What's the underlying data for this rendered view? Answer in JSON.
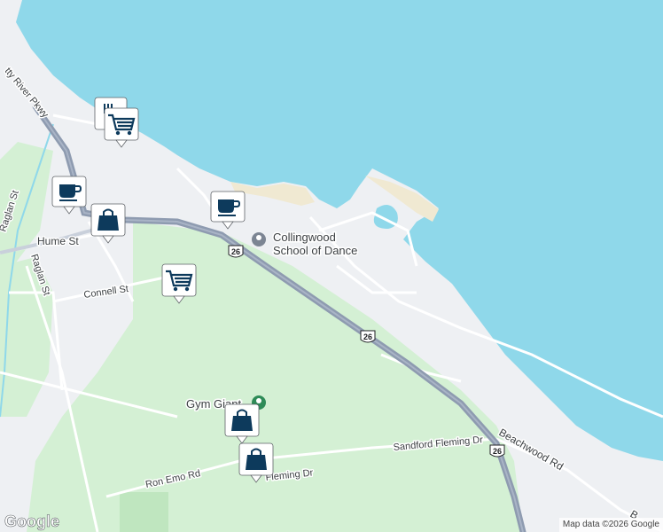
{
  "map": {
    "colors": {
      "water": "#8fd8ea",
      "land": "#eef0f3",
      "park": "#d4f0d4",
      "road_major": "#8e9bb0",
      "road_minor": "#ffffff",
      "marker_bg": "#ffffff",
      "marker_icon": "#0d3a5c"
    },
    "streets": {
      "black_ash_creek_pkwy": "tty River Pkwy",
      "hume_st": "Hume St",
      "raglan_st_upper": "Raglan St",
      "raglan_st_lower": "Raglan St",
      "connell_st": "Connell St",
      "ron_emo_rd": "Ron Emo Rd",
      "sandford_fleming_dr_upper": "Sandford Fleming Dr",
      "sandford_fleming_dr_lower": "Fleming Dr",
      "beachwood_rd": "Beachwood Rd",
      "beachwood_rd_edge": "B"
    },
    "route_shields": {
      "r1": "26",
      "r2": "26",
      "r3": "26"
    },
    "places": {
      "school_of_dance_line1": "Collingwood",
      "school_of_dance_line2": "School of Dance",
      "gym": "Gym Giant"
    },
    "markers": [
      {
        "icon": "restaurant-icon"
      },
      {
        "icon": "shopping-cart-icon"
      },
      {
        "icon": "coffee-icon"
      },
      {
        "icon": "shopping-bag-icon"
      },
      {
        "icon": "coffee-icon"
      },
      {
        "icon": "shopping-cart-icon"
      },
      {
        "icon": "shopping-bag-icon"
      },
      {
        "icon": "shopping-bag-icon"
      }
    ],
    "google_logo": "Google",
    "attribution": "Map data ©2026 Google"
  }
}
